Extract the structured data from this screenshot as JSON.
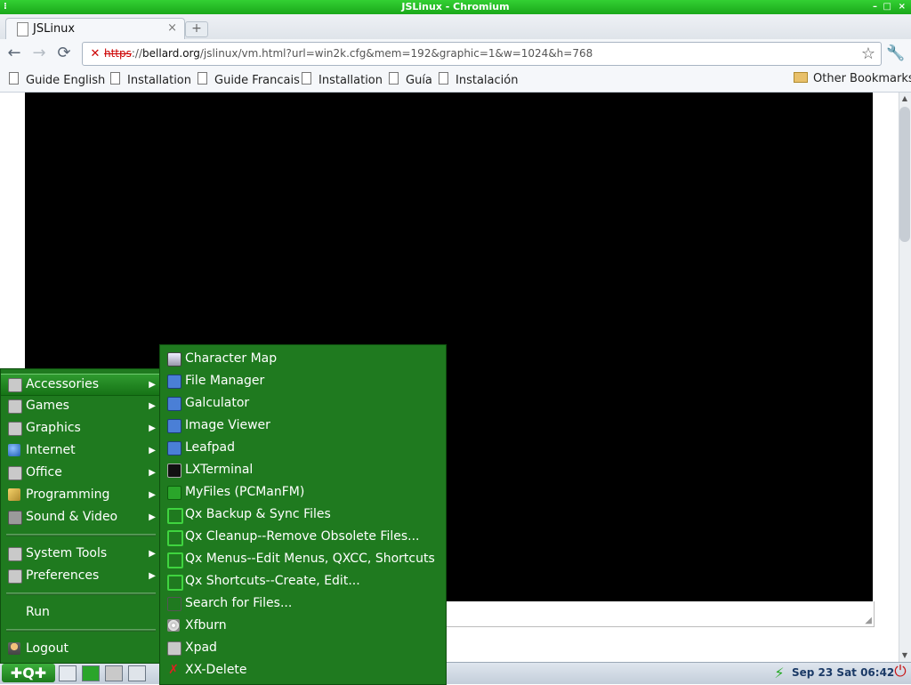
{
  "window": {
    "title": "JSLinux - Chromium"
  },
  "tab": {
    "title": "JSLinux",
    "close_glyph": "×",
    "new_tab_glyph": "+"
  },
  "toolbar": {
    "back_glyph": "←",
    "forward_glyph": "→",
    "reload_glyph": "⟳",
    "url_scheme": "https",
    "url_separator": "://",
    "url_host": "bellard.org",
    "url_path": "/jslinux/vm.html?url=win2k.cfg&mem=192&graphic=1&w=1024&h=768",
    "star_glyph": "☆",
    "wrench_glyph": "🔧"
  },
  "bookmarks": {
    "items": [
      "Guide English",
      "Installation",
      "Guide Francais",
      "Installation",
      "Guía",
      "Instalación"
    ],
    "other": "Other Bookmarks"
  },
  "start_menu": {
    "items": [
      {
        "label": "Accessories",
        "icon": "gear-icon",
        "has_submenu": true,
        "selected": true
      },
      {
        "label": "Games",
        "icon": "gear-icon",
        "has_submenu": true
      },
      {
        "label": "Graphics",
        "icon": "gear-icon",
        "has_submenu": true
      },
      {
        "label": "Internet",
        "icon": "globe-icon",
        "has_submenu": true
      },
      {
        "label": "Office",
        "icon": "gear-icon",
        "has_submenu": true
      },
      {
        "label": "Programming",
        "icon": "brush-icon",
        "has_submenu": true
      },
      {
        "label": "Sound & Video",
        "icon": "media-icon",
        "has_submenu": true
      },
      {
        "label": "System Tools",
        "icon": "gear-icon",
        "has_submenu": true
      },
      {
        "label": "Preferences",
        "icon": "tools-icon",
        "has_submenu": true
      },
      {
        "label": "Run",
        "icon": "",
        "has_submenu": false
      },
      {
        "label": "Logout",
        "icon": "logout-icon",
        "has_submenu": false
      }
    ],
    "arrow_glyph": "▶"
  },
  "submenu": {
    "items": [
      {
        "label": "Character Map",
        "icon": "character-map-icon"
      },
      {
        "label": "File Manager",
        "icon": "file-manager-icon"
      },
      {
        "label": "Galculator",
        "icon": "calculator-icon"
      },
      {
        "label": "Image Viewer",
        "icon": "image-viewer-icon"
      },
      {
        "label": "Leafpad",
        "icon": "leafpad-icon"
      },
      {
        "label": "LXTerminal",
        "icon": "terminal-icon"
      },
      {
        "label": "MyFiles  (PCManFM)",
        "icon": "folder-icon"
      },
      {
        "label": "Qx Backup & Sync Files",
        "icon": "qx-icon"
      },
      {
        "label": "Qx Cleanup--Remove Obsolete Files...",
        "icon": "qx-icon"
      },
      {
        "label": "Qx Menus--Edit Menus, QXCC, Shortcuts",
        "icon": "qx-icon"
      },
      {
        "label": "Qx Shortcuts--Create, Edit...",
        "icon": "qx-icon"
      },
      {
        "label": "Search for Files...",
        "icon": "search-icon"
      },
      {
        "label": "Xfburn",
        "icon": "disc-icon"
      },
      {
        "label": "Xpad",
        "icon": "xpad-icon"
      },
      {
        "label": "XX-Delete",
        "icon": "delete-icon"
      }
    ]
  },
  "taskbar": {
    "start_label": "✚Q✚",
    "clock": "Sep 23 Sat 06:42",
    "power_glyph": "⏻",
    "network_glyph": "⚡"
  },
  "colors": {
    "menu_bg": "#1f7a1f",
    "titlebar": "#1aa81a",
    "vm_screen": "#000000"
  }
}
